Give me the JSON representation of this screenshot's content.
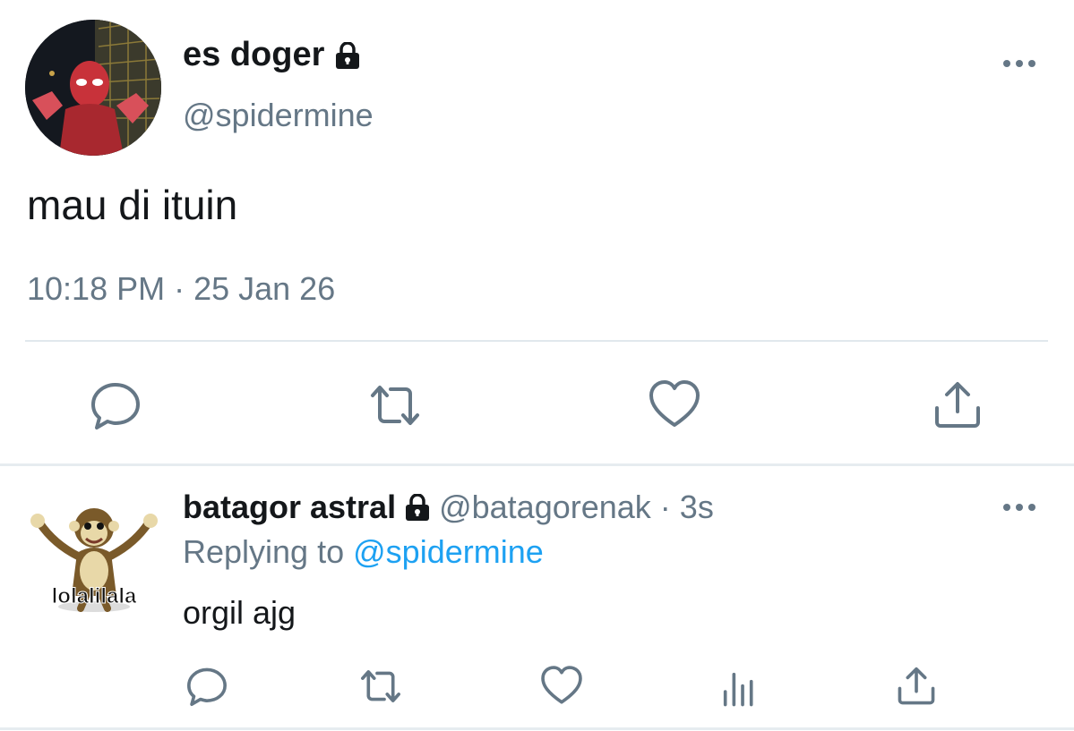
{
  "main_tweet": {
    "display_name": "es doger",
    "handle": "@spidermine",
    "text": "mau di ituin",
    "timestamp": "10:18 PM · 25 Jan 26"
  },
  "reply": {
    "display_name": "batagor astral",
    "handle": "@batagorenak",
    "separator": "·",
    "time": "3s",
    "replying_prefix": "Replying to",
    "replying_handle": "@spidermine",
    "text": "orgil ajg",
    "avatar_caption": "lolalilala"
  },
  "icons": {
    "lock": "lock-icon",
    "more": "more-horizontal-icon",
    "reply": "reply-icon",
    "retweet": "retweet-icon",
    "like": "heart-icon",
    "share": "share-icon",
    "analytics": "analytics-icon"
  },
  "colors": {
    "text": "#14171a",
    "secondary": "#657786",
    "link": "#1da1f2",
    "divider": "#e1e8ed"
  }
}
